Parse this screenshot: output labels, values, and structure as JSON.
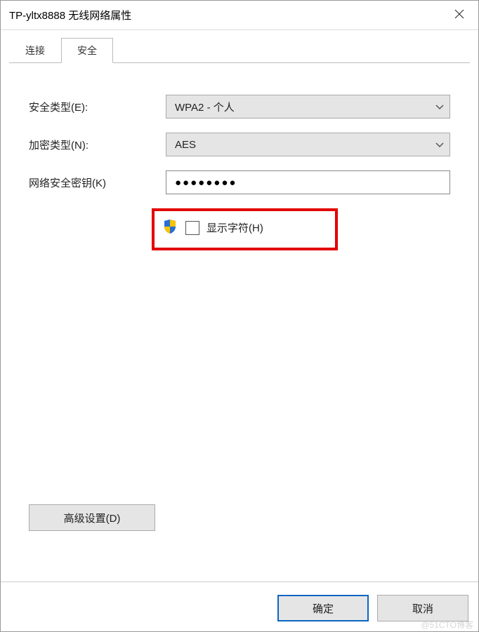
{
  "window": {
    "title": "TP-yltx8888 无线网络属性"
  },
  "tabs": {
    "connect": "连接",
    "security": "安全"
  },
  "form": {
    "security_type_label": "安全类型(E):",
    "security_type_value": "WPA2 - 个人",
    "encryption_label": "加密类型(N):",
    "encryption_value": "AES",
    "network_key_label": "网络安全密钥(K)",
    "network_key_value": "●●●●●●●●",
    "show_chars_label": "显示字符(H)"
  },
  "buttons": {
    "advanced": "高级设置(D)",
    "ok": "确定",
    "cancel": "取消"
  },
  "watermark": "@51CTO博客"
}
